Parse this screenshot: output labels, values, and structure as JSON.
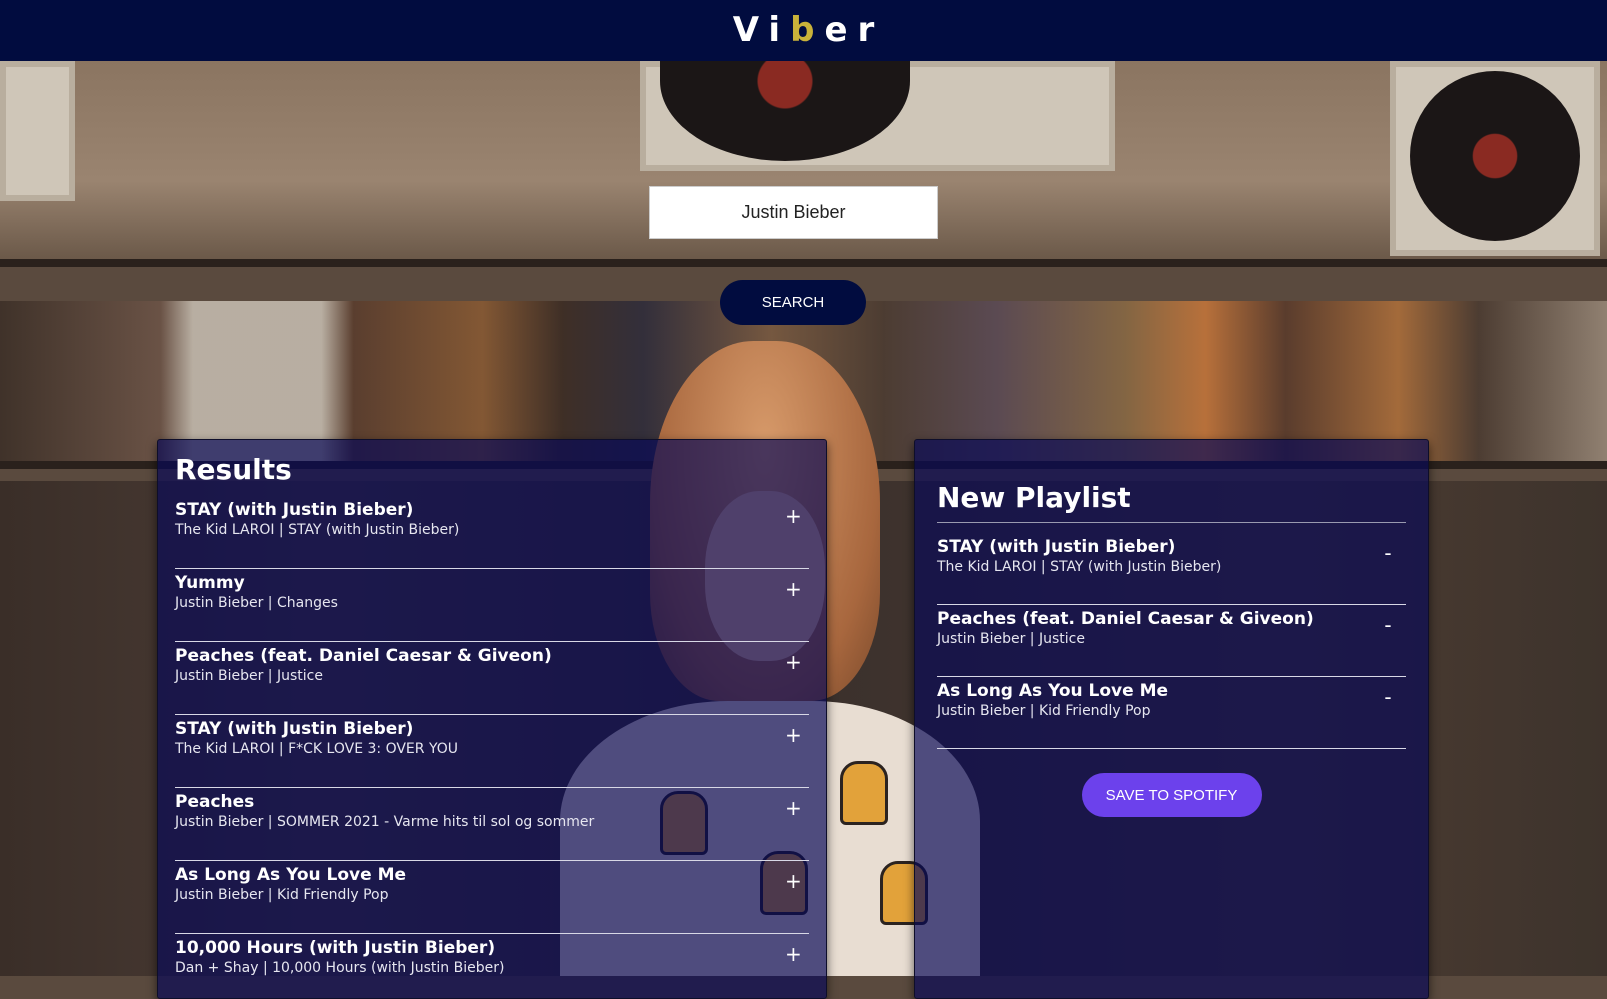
{
  "app": {
    "logo_pre": "Vi",
    "logo_hl": "b",
    "logo_post": "er"
  },
  "search": {
    "value": "Justin Bieber",
    "button_label": "SEARCH"
  },
  "results": {
    "title": "Results",
    "action_symbol": "+",
    "tracks": [
      {
        "name": "STAY (with Justin Bieber)",
        "info": "The Kid LAROI | STAY (with Justin Bieber)"
      },
      {
        "name": "Yummy",
        "info": "Justin Bieber | Changes"
      },
      {
        "name": "Peaches (feat. Daniel Caesar & Giveon)",
        "info": "Justin Bieber | Justice"
      },
      {
        "name": "STAY (with Justin Bieber)",
        "info": "The Kid LAROI | F*CK LOVE 3: OVER YOU"
      },
      {
        "name": "Peaches",
        "info": "Justin Bieber | SOMMER 2021 - Varme hits til sol og sommer"
      },
      {
        "name": "As Long As You Love Me",
        "info": "Justin Bieber | Kid Friendly Pop"
      },
      {
        "name": "10,000 Hours (with Justin Bieber)",
        "info": "Dan + Shay | 10,000 Hours (with Justin Bieber)"
      }
    ]
  },
  "playlist": {
    "title": "New Playlist",
    "action_symbol": "-",
    "tracks": [
      {
        "name": "STAY (with Justin Bieber)",
        "info": "The Kid LAROI | STAY (with Justin Bieber)"
      },
      {
        "name": "Peaches (feat. Daniel Caesar & Giveon)",
        "info": "Justin Bieber | Justice"
      },
      {
        "name": "As Long As You Love Me",
        "info": "Justin Bieber | Kid Friendly Pop"
      }
    ],
    "save_label": "SAVE TO SPOTIFY"
  },
  "colors": {
    "header_bg": "#010c3f",
    "logo_accent": "#c9b23a",
    "save_button": "#6c41ec",
    "panel_bg": "#060855"
  }
}
